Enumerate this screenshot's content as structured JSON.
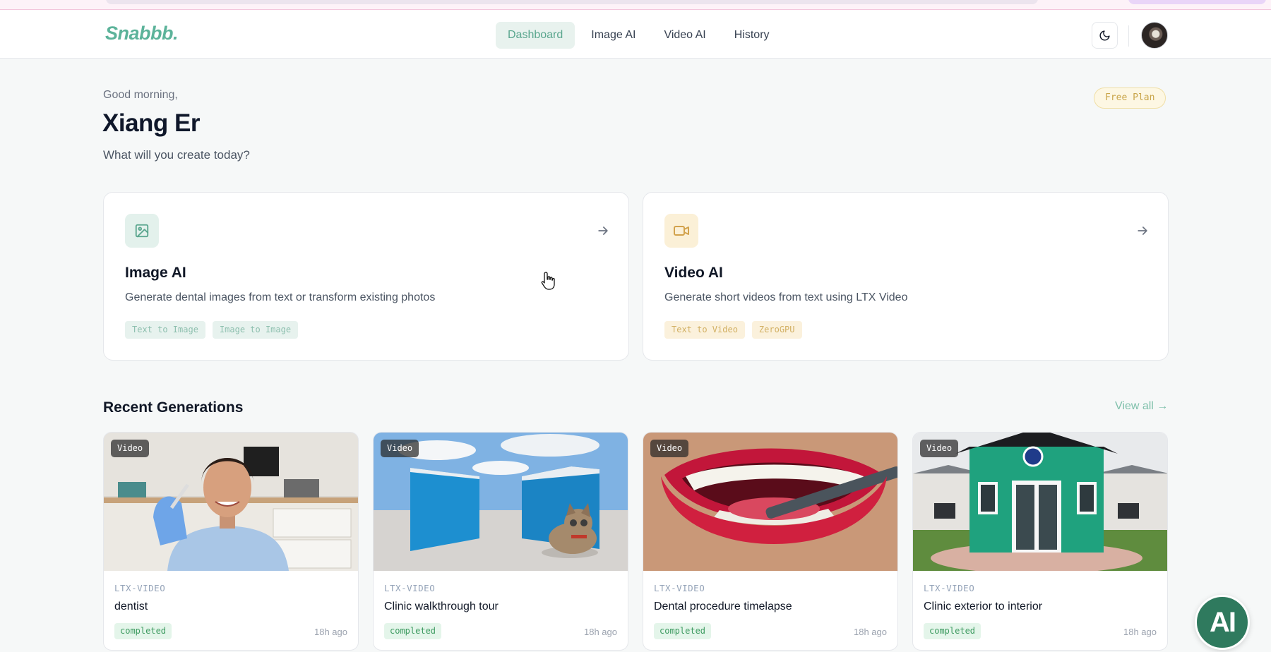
{
  "app": {
    "logo": "Snabbb."
  },
  "nav": {
    "items": [
      {
        "label": "Dashboard",
        "active": true
      },
      {
        "label": "Image AI",
        "active": false
      },
      {
        "label": "Video AI",
        "active": false
      },
      {
        "label": "History",
        "active": false
      }
    ],
    "theme_icon": "moon-icon"
  },
  "welcome": {
    "greeting": "Good morning,",
    "name": "Xiang Er",
    "subtitle": "What will you create today?",
    "plan": "Free Plan"
  },
  "tools": [
    {
      "icon": "image-icon",
      "title": "Image AI",
      "description": "Generate dental images from text or transform existing photos",
      "tags": [
        "Text to Image",
        "Image to Image"
      ]
    },
    {
      "icon": "video-camera-icon",
      "title": "Video AI",
      "description": "Generate short videos from text using LTX Video",
      "tags": [
        "Text to Video",
        "ZeroGPU"
      ]
    }
  ],
  "recent": {
    "title": "Recent Generations",
    "view_all": "View all →",
    "items": [
      {
        "type": "Video",
        "model": "LTX-VIDEO",
        "title": "dentist",
        "status": "completed",
        "time": "18h ago"
      },
      {
        "type": "Video",
        "model": "LTX-VIDEO",
        "title": "Clinic walkthrough tour",
        "status": "completed",
        "time": "18h ago"
      },
      {
        "type": "Video",
        "model": "LTX-VIDEO",
        "title": "Dental procedure timelapse",
        "status": "completed",
        "time": "18h ago"
      },
      {
        "type": "Video",
        "model": "LTX-VIDEO",
        "title": "Clinic exterior to interior",
        "status": "completed",
        "time": "18h ago"
      }
    ]
  },
  "fab": {
    "label": "AI"
  },
  "colors": {
    "accent": "#5cb39a",
    "video_accent": "#d2b063",
    "fab": "#2f7a5e"
  }
}
